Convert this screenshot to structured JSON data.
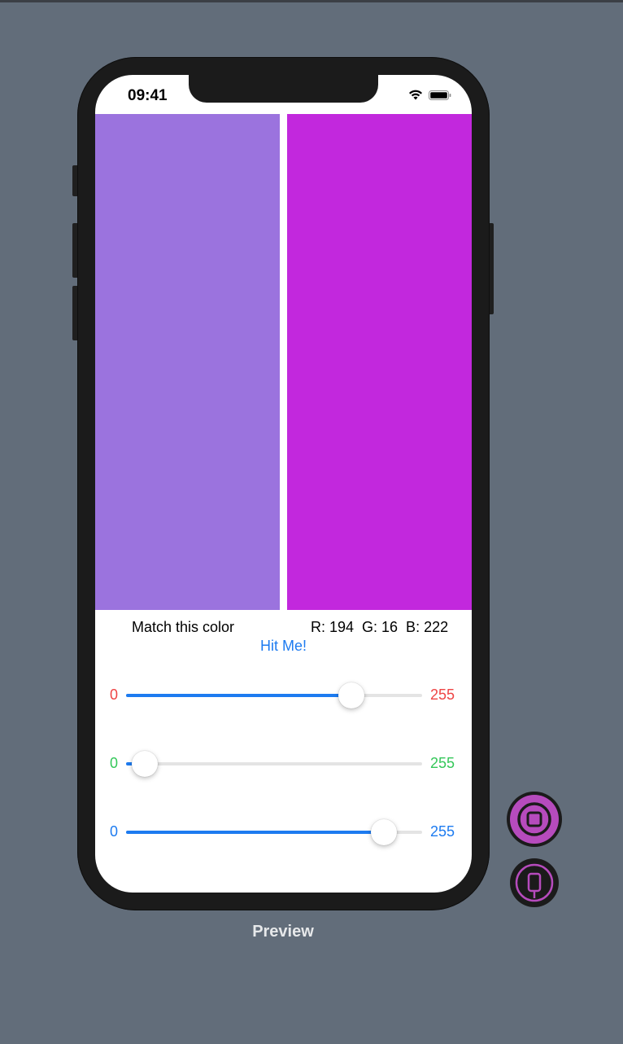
{
  "status_bar": {
    "time": "09:41",
    "wifi_icon": "wifi-icon",
    "battery_icon": "battery-icon"
  },
  "swatches": {
    "target_color": "#9b73de",
    "guess_color": "#c228dd"
  },
  "labels": {
    "target_text": "Match this color",
    "rgb_text": "R: 194  G: 16  B: 222"
  },
  "hit_button": {
    "label": "Hit Me!",
    "color": "#1d7bf0"
  },
  "sliders": [
    {
      "channel": "red",
      "min_label": "0",
      "max_label": "255",
      "value": 194,
      "max": 255,
      "color": "#ee4444"
    },
    {
      "channel": "green",
      "min_label": "0",
      "max_label": "255",
      "value": 16,
      "max": 255,
      "color": "#34c759"
    },
    {
      "channel": "blue",
      "min_label": "0",
      "max_label": "255",
      "value": 222,
      "max": 255,
      "color": "#1d7bf0"
    }
  ],
  "preview": {
    "label": "Preview",
    "live_button_icon": "live-preview-icon",
    "device_button_icon": "device-preview-icon",
    "accent_color": "#b64bbd"
  }
}
